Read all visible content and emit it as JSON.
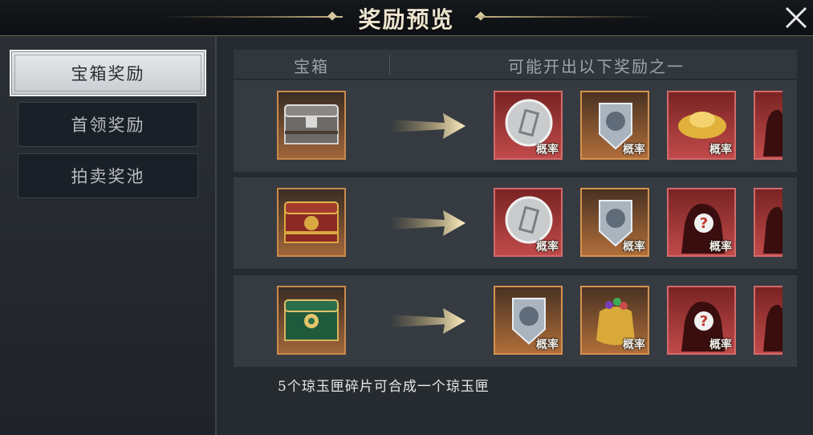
{
  "window": {
    "title": "奖励预览"
  },
  "sidebar": {
    "tabs": [
      {
        "label": "宝箱奖励",
        "active": true
      },
      {
        "label": "首领奖励",
        "active": false
      },
      {
        "label": "拍卖奖池",
        "active": false
      }
    ]
  },
  "table": {
    "header_chest": "宝箱",
    "header_rewards": "可能开出以下奖励之一",
    "rows": [
      {
        "chest_icon": "silver-chest-icon",
        "rewards": [
          {
            "icon": "silver-token-icon",
            "label": "概率"
          },
          {
            "icon": "silver-crest-icon",
            "label": "概率"
          },
          {
            "icon": "gold-ingot-icon",
            "label": "概率"
          },
          {
            "icon": "mystery-figure-icon",
            "label": ""
          }
        ]
      },
      {
        "chest_icon": "red-gold-chest-icon",
        "rewards": [
          {
            "icon": "silver-token-icon",
            "label": "概率"
          },
          {
            "icon": "silver-crest-icon",
            "label": "概率"
          },
          {
            "icon": "mystery-figure-icon",
            "label": "概率"
          },
          {
            "icon": "mystery-figure-icon",
            "label": ""
          }
        ]
      },
      {
        "chest_icon": "jade-chest-icon",
        "rewards": [
          {
            "icon": "silver-crest-icon",
            "label": "概率"
          },
          {
            "icon": "treasure-bag-icon",
            "label": "概率"
          },
          {
            "icon": "mystery-figure-icon",
            "label": "概率"
          },
          {
            "icon": "mystery-figure-icon",
            "label": ""
          }
        ]
      }
    ]
  },
  "footer_note": "5个琼玉匣碎片可合成一个琼玉匣"
}
